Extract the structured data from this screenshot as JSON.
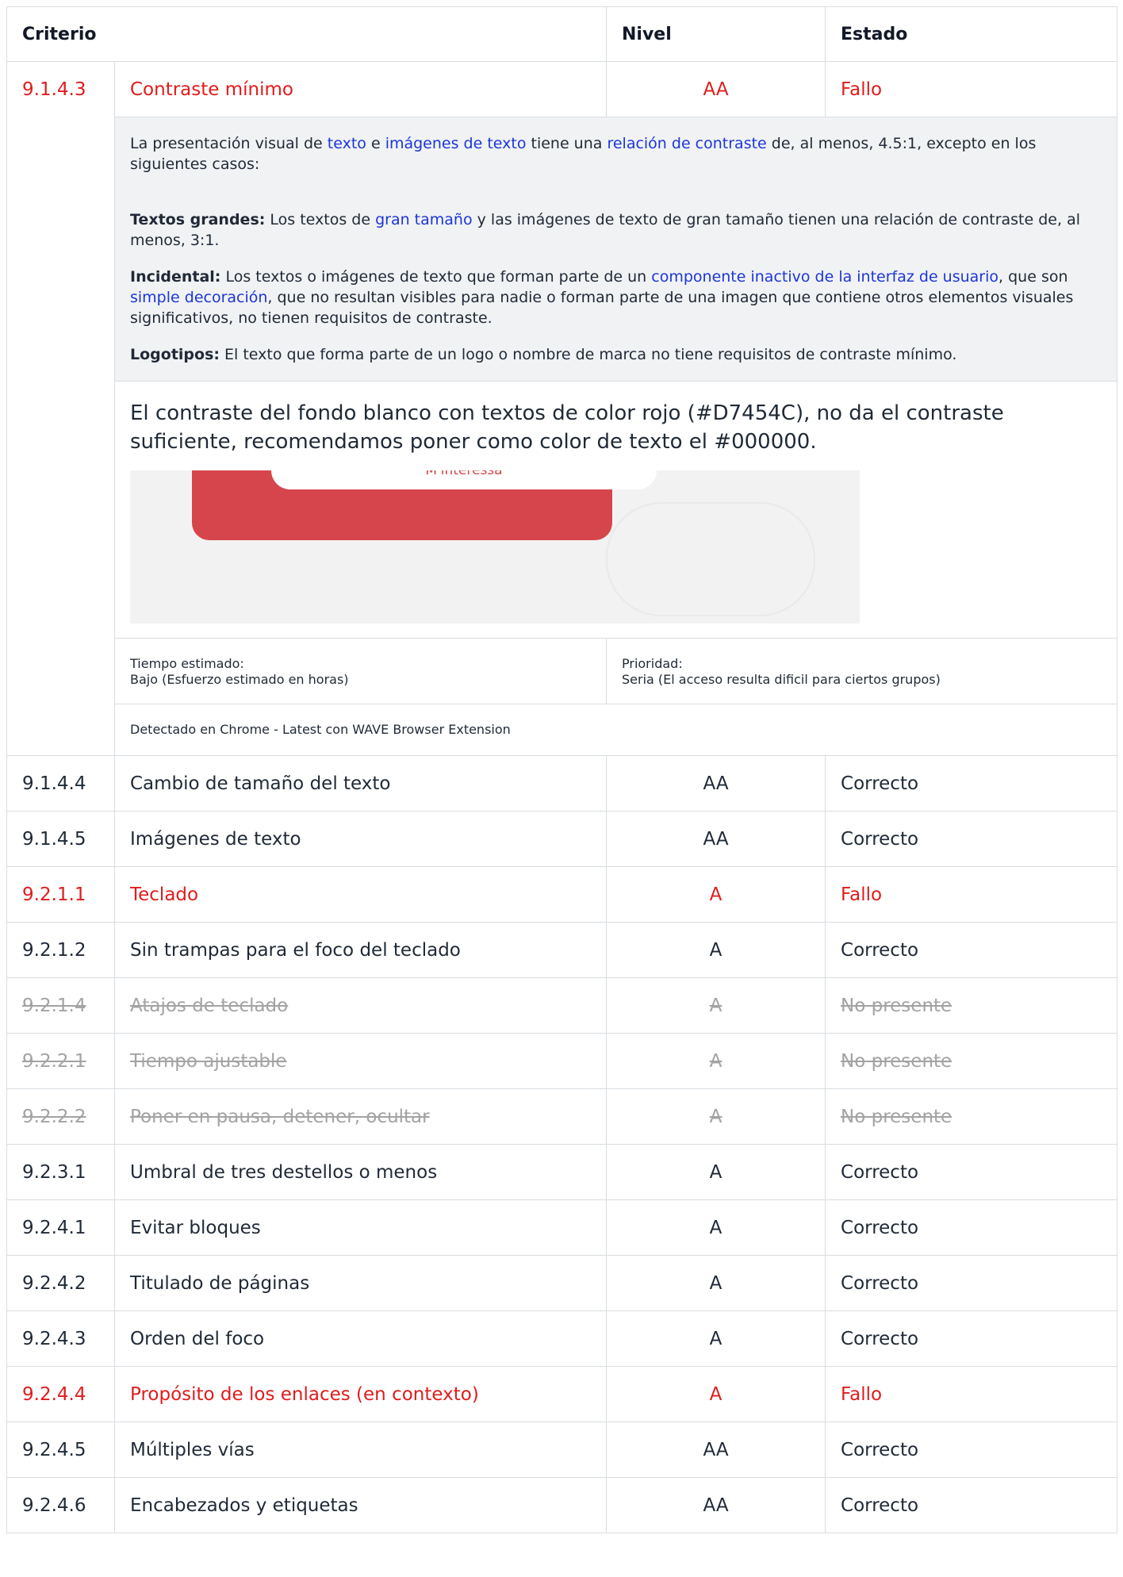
{
  "headers": {
    "criterio": "Criterio",
    "nivel": "Nivel",
    "estado": "Estado"
  },
  "expanded": {
    "id": "9.1.4.3",
    "name": "Contraste mínimo",
    "level": "AA",
    "status": "Fallo",
    "desc": {
      "p1_a": "La presentación visual de ",
      "p1_link1": "texto",
      "p1_b": " e ",
      "p1_link2": "imágenes de texto",
      "p1_c": " tiene una ",
      "p1_link3": "relación de contraste",
      "p1_d": " de, al menos, 4.5:1, excepto en los siguientes casos:",
      "p2_label": "Textos grandes:",
      "p2_a": " Los textos de ",
      "p2_link": "gran tamaño",
      "p2_b": " y las imágenes de texto de gran tamaño tienen una relación de contraste de, al menos, 3:1.",
      "p3_label": "Incidental:",
      "p3_a": " Los textos o imágenes de texto que forman parte de un ",
      "p3_link1": "componente inactivo de la interfaz de usuario",
      "p3_b": ", que son ",
      "p3_link2": "simple decoración",
      "p3_c": ", que no resultan visibles para nadie o forman parte de una imagen que contiene otros elementos visuales significativos, no tienen requisitos de contraste.",
      "p4_label": "Logotipos:",
      "p4_a": " El texto que forma parte de un logo o nombre de marca no tiene requisitos de contraste mínimo."
    },
    "finding": "El contraste del fondo blanco con textos de color rojo (#D7454C), no da el contraste suficiente, recomendamos poner como color de texto el #000000.",
    "screenshot_button": "M'interessa",
    "time_label": "Tiempo estimado:",
    "time_value": "Bajo (Esfuerzo estimado en horas)",
    "priority_label": "Prioridad:",
    "priority_value": "Seria (El acceso resulta dificil para ciertos grupos)",
    "detected": "Detectado en Chrome - Latest con WAVE Browser Extension"
  },
  "rows": [
    {
      "id": "9.1.4.4",
      "name": "Cambio de tamaño del texto",
      "level": "AA",
      "status": "Correcto",
      "state": "ok"
    },
    {
      "id": "9.1.4.5",
      "name": "Imágenes de texto",
      "level": "AA",
      "status": "Correcto",
      "state": "ok"
    },
    {
      "id": "9.2.1.1",
      "name": "Teclado",
      "level": "A",
      "status": "Fallo",
      "state": "fail"
    },
    {
      "id": "9.2.1.2",
      "name": "Sin trampas para el foco del teclado",
      "level": "A",
      "status": "Correcto",
      "state": "ok"
    },
    {
      "id": "9.2.1.4",
      "name": "Atajos de teclado",
      "level": "A",
      "status": "No presente",
      "state": "np"
    },
    {
      "id": "9.2.2.1",
      "name": "Tiempo ajustable",
      "level": "A",
      "status": "No presente",
      "state": "np"
    },
    {
      "id": "9.2.2.2",
      "name": "Poner en pausa, detener, ocultar",
      "level": "A",
      "status": "No presente",
      "state": "np"
    },
    {
      "id": "9.2.3.1",
      "name": "Umbral de tres destellos o menos",
      "level": "A",
      "status": "Correcto",
      "state": "ok"
    },
    {
      "id": "9.2.4.1",
      "name": "Evitar bloques",
      "level": "A",
      "status": "Correcto",
      "state": "ok"
    },
    {
      "id": "9.2.4.2",
      "name": "Titulado de páginas",
      "level": "A",
      "status": "Correcto",
      "state": "ok"
    },
    {
      "id": "9.2.4.3",
      "name": "Orden del foco",
      "level": "A",
      "status": "Correcto",
      "state": "ok"
    },
    {
      "id": "9.2.4.4",
      "name": "Propósito de los enlaces (en contexto)",
      "level": "A",
      "status": "Fallo",
      "state": "fail"
    },
    {
      "id": "9.2.4.5",
      "name": "Múltiples vías",
      "level": "AA",
      "status": "Correcto",
      "state": "ok"
    },
    {
      "id": "9.2.4.6",
      "name": "Encabezados y etiquetas",
      "level": "AA",
      "status": "Correcto",
      "state": "ok"
    }
  ],
  "colors": {
    "fail": "#e01c1c",
    "link": "#1b36d8",
    "not_present": "#a3a3a3",
    "brand_red": "#D7454C"
  }
}
